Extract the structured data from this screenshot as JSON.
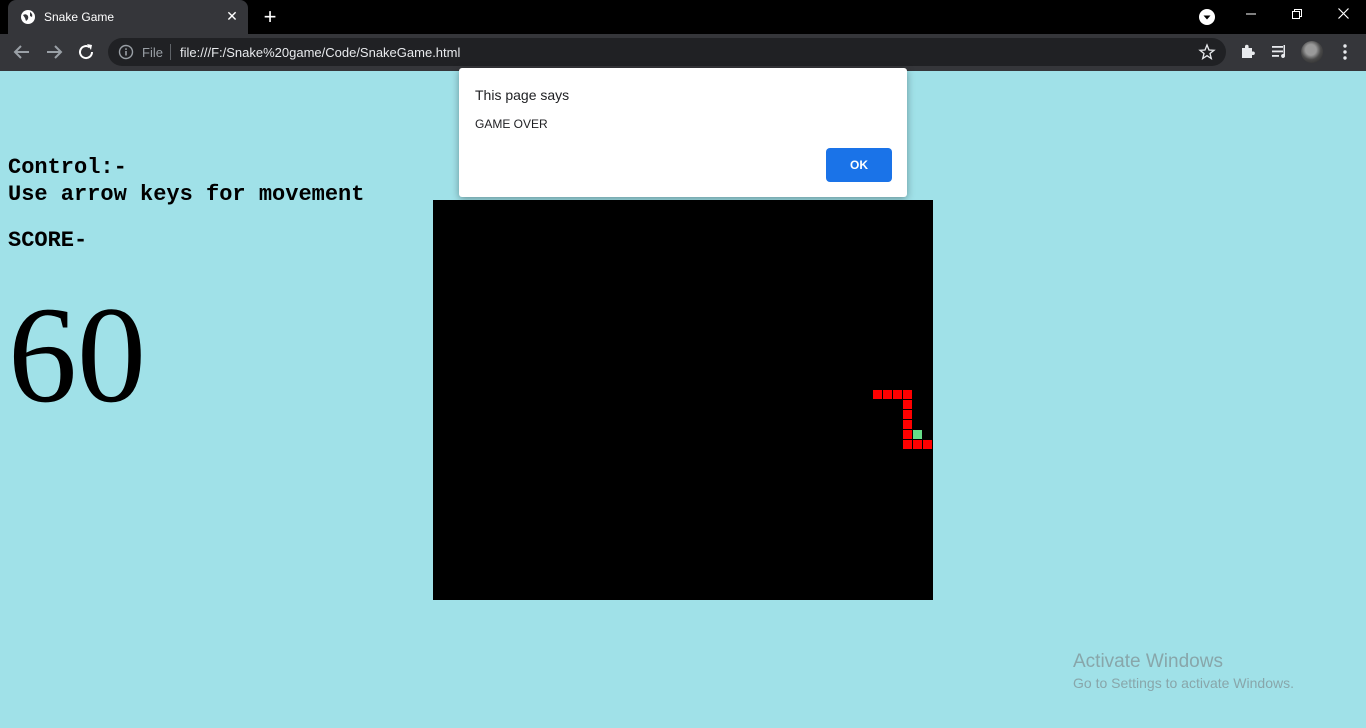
{
  "browser": {
    "tab_title": "Snake Game",
    "new_tab_symbol": "+",
    "scheme_label": "File",
    "url": "file:///F:/Snake%20game/Code/SnakeGame.html"
  },
  "page": {
    "control_heading": "Control:-",
    "control_text": "Use arrow keys for movement",
    "score_label": "SCORE-",
    "score_value": "60"
  },
  "game": {
    "board_color": "#000000",
    "snake_color": "#ff0000",
    "head_color": "#66dd88",
    "grid_cols": 50,
    "grid_rows": 40,
    "snake_cells": [
      [
        44,
        19
      ],
      [
        45,
        19
      ],
      [
        46,
        19
      ],
      [
        47,
        19
      ],
      [
        47,
        20
      ],
      [
        47,
        21
      ],
      [
        47,
        22
      ],
      [
        47,
        23
      ],
      [
        47,
        24
      ],
      [
        48,
        24
      ],
      [
        49,
        24
      ]
    ],
    "head_cell": [
      48,
      23
    ]
  },
  "dialog": {
    "title": "This page says",
    "message": "GAME OVER",
    "ok_label": "OK"
  },
  "watermark": {
    "title": "Activate Windows",
    "subtitle": "Go to Settings to activate Windows."
  },
  "colors": {
    "page_background": "#a0e1e8",
    "ok_button": "#1a73e8"
  }
}
